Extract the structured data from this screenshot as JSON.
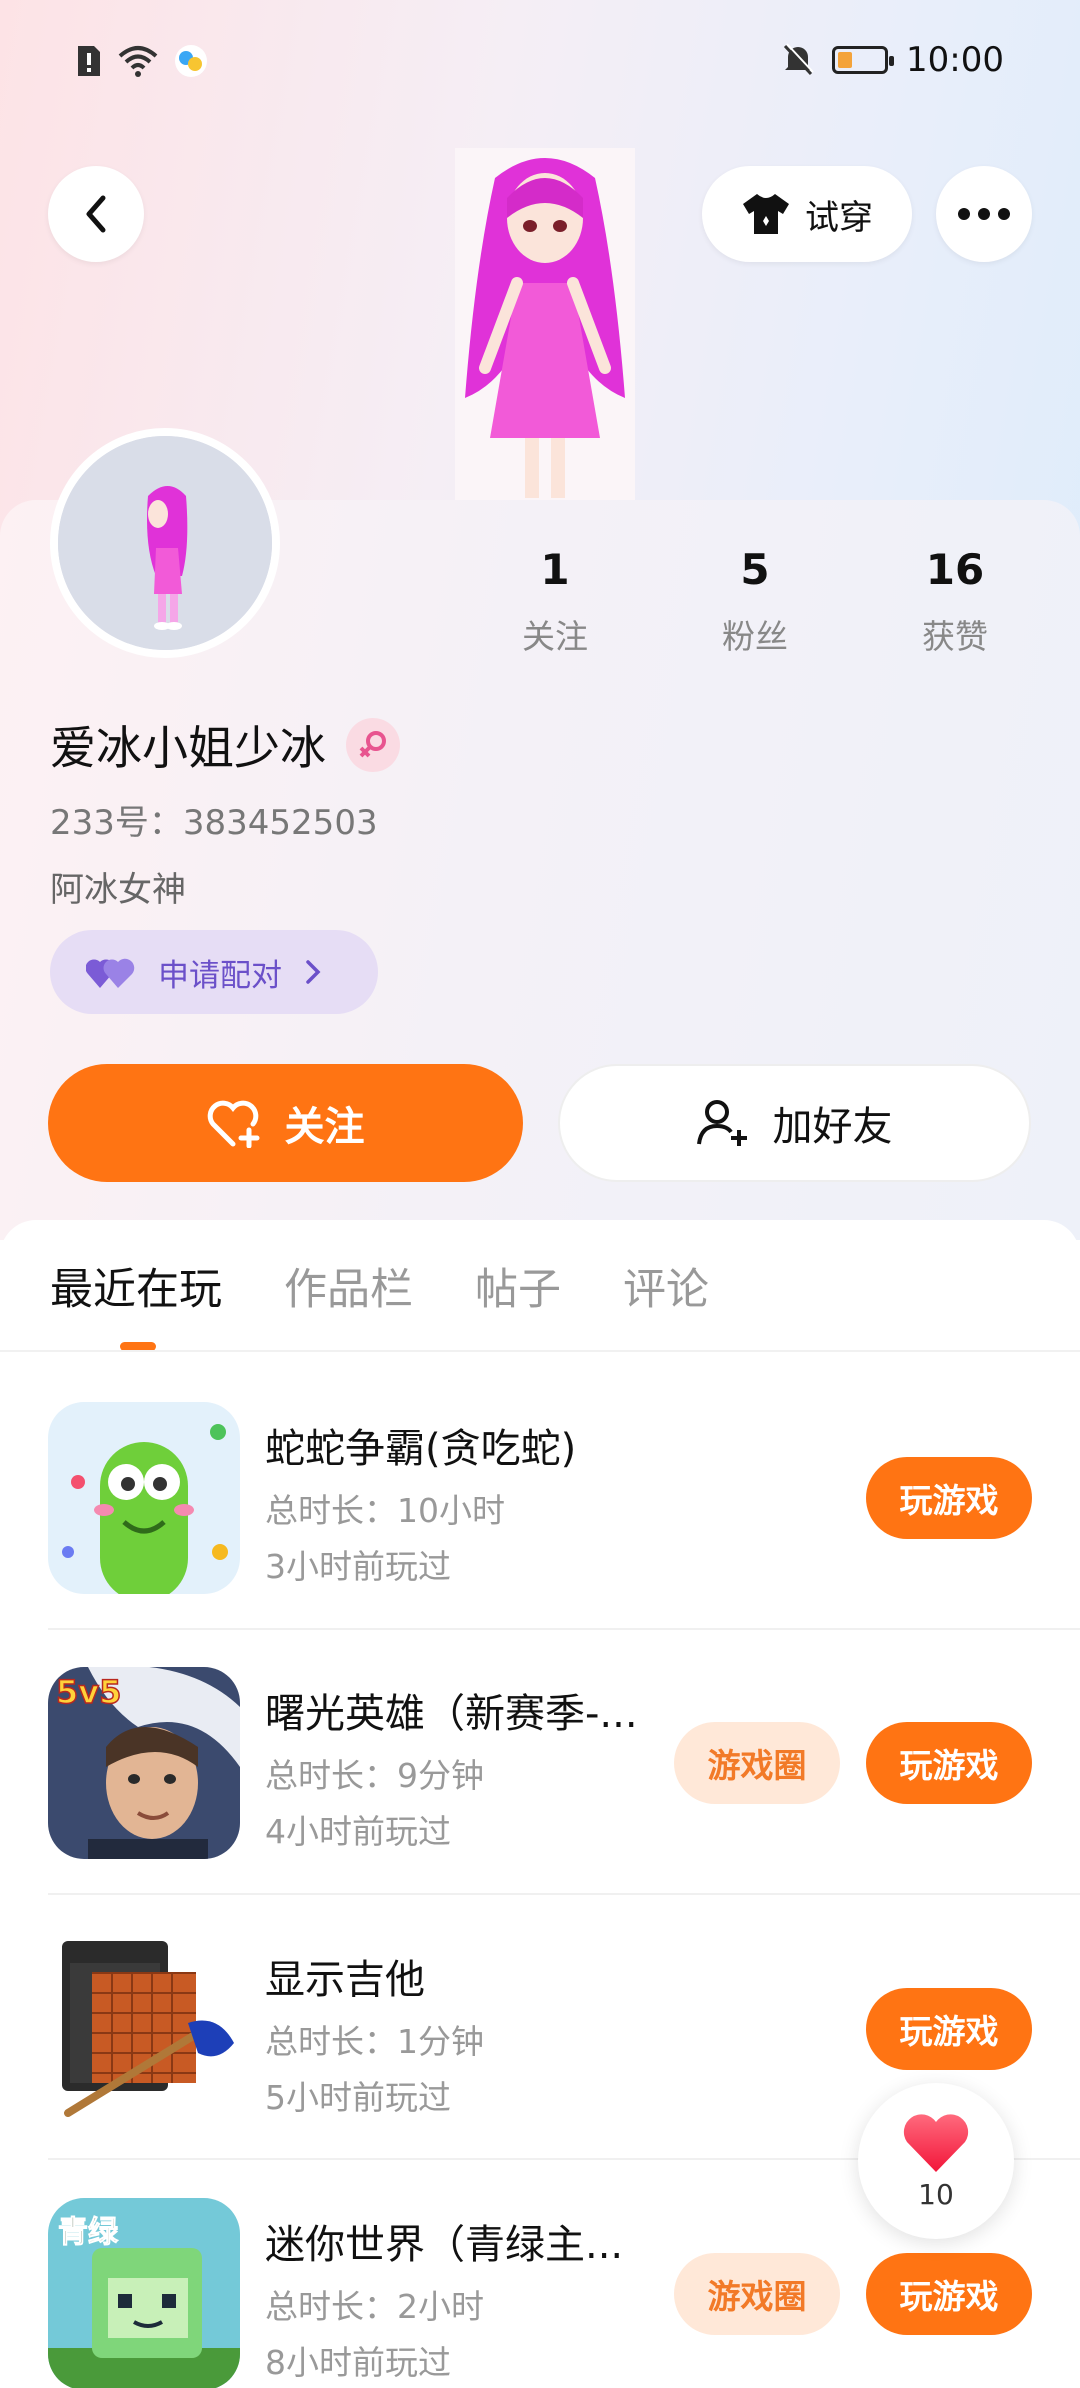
{
  "status_bar": {
    "time": "10:00"
  },
  "header": {
    "try_on_label": "试穿"
  },
  "profile": {
    "name": "爱冰小姐少冰",
    "uid": "233号：383452503",
    "bio": "阿冰女神",
    "pair_label": "申请配对",
    "stats": [
      {
        "value": "1",
        "label": "关注"
      },
      {
        "value": "5",
        "label": "粉丝"
      },
      {
        "value": "16",
        "label": "获赞"
      }
    ],
    "follow_label": "关注",
    "add_friend_label": "加好友"
  },
  "tabs": [
    "最近在玩",
    "作品栏",
    "帖子",
    "评论"
  ],
  "games": [
    {
      "title": "蛇蛇争霸(贪吃蛇)",
      "duration": "总时长：10小时",
      "last_played": "3小时前玩过",
      "play_label": "玩游戏",
      "circle_label": ""
    },
    {
      "title": "曙光英雄（新赛季-...",
      "duration": "总时长：9分钟",
      "last_played": "4小时前玩过",
      "play_label": "玩游戏",
      "circle_label": "游戏圈",
      "badge": "5v5"
    },
    {
      "title": "显示吉他",
      "duration": "总时长：1分钟",
      "last_played": "5小时前玩过",
      "play_label": "玩游戏",
      "circle_label": ""
    },
    {
      "title": "迷你世界（青绿主...",
      "duration": "总时长：2小时",
      "last_played": "8小时前玩过",
      "play_label": "玩游戏",
      "circle_label": "游戏圈",
      "badge": "青绿"
    }
  ],
  "like_float": {
    "count": "10"
  },
  "colors": {
    "accent": "#ff7413",
    "pair_text": "#6b50c9",
    "pink_hair": "#e032d8"
  }
}
